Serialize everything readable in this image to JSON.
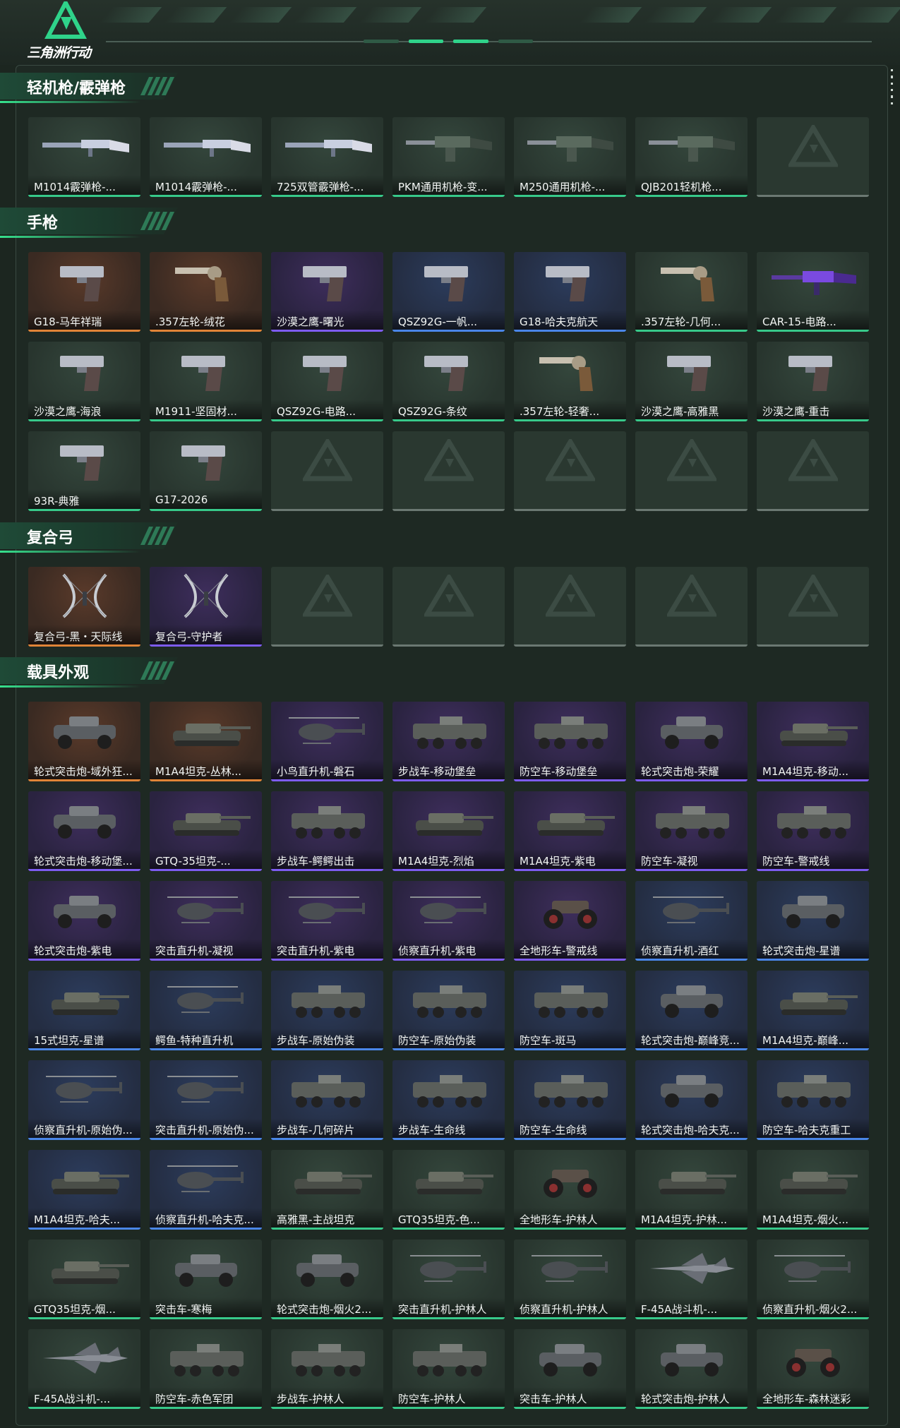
{
  "app": {
    "logo_text": "三角洲行动"
  },
  "sections": [
    {
      "title": "轻机枪/霰弹枪",
      "items": [
        {
          "label": "M1014霰弹枪-...",
          "rarity": "green",
          "kind": "shotgun"
        },
        {
          "label": "M1014霰弹枪-...",
          "rarity": "green",
          "kind": "shotgun"
        },
        {
          "label": "725双管霰弹枪-...",
          "rarity": "green",
          "kind": "shotgun"
        },
        {
          "label": "PKM通用机枪-变...",
          "rarity": "green",
          "kind": "mg"
        },
        {
          "label": "M250通用机枪-...",
          "rarity": "green",
          "kind": "mg"
        },
        {
          "label": "QJB201轻机枪...",
          "rarity": "green",
          "kind": "mg"
        },
        {
          "label": "",
          "rarity": "empty",
          "kind": "empty"
        }
      ]
    },
    {
      "title": "手枪",
      "items": [
        {
          "label": "G18-马年祥瑞",
          "rarity": "orange",
          "kind": "pistol"
        },
        {
          "label": ".357左轮-绒花",
          "rarity": "orange",
          "kind": "revolver"
        },
        {
          "label": "沙漠之鹰-曙光",
          "rarity": "purple",
          "kind": "pistol"
        },
        {
          "label": "QSZ92G-一帆...",
          "rarity": "blue",
          "kind": "pistol"
        },
        {
          "label": "G18-哈夫克航天",
          "rarity": "blue",
          "kind": "pistol"
        },
        {
          "label": ".357左轮-几何...",
          "rarity": "green",
          "kind": "revolver"
        },
        {
          "label": "CAR-15-电路...",
          "rarity": "green",
          "kind": "rifle"
        },
        {
          "label": "沙漠之鹰-海浪",
          "rarity": "green",
          "kind": "pistol"
        },
        {
          "label": "M1911-坚固材...",
          "rarity": "green",
          "kind": "pistol"
        },
        {
          "label": "QSZ92G-电路...",
          "rarity": "green",
          "kind": "pistol"
        },
        {
          "label": "QSZ92G-条纹",
          "rarity": "green",
          "kind": "pistol"
        },
        {
          "label": ".357左轮-轻奢...",
          "rarity": "green",
          "kind": "revolver"
        },
        {
          "label": "沙漠之鹰-高雅黑",
          "rarity": "green",
          "kind": "pistol"
        },
        {
          "label": "沙漠之鹰-重击",
          "rarity": "green",
          "kind": "pistol"
        },
        {
          "label": "93R-典雅",
          "rarity": "green",
          "kind": "pistol"
        },
        {
          "label": "G17-2026",
          "rarity": "green",
          "kind": "pistol"
        },
        {
          "label": "",
          "rarity": "empty",
          "kind": "empty"
        },
        {
          "label": "",
          "rarity": "empty",
          "kind": "empty"
        },
        {
          "label": "",
          "rarity": "empty",
          "kind": "empty"
        },
        {
          "label": "",
          "rarity": "empty",
          "kind": "empty"
        },
        {
          "label": "",
          "rarity": "empty",
          "kind": "empty"
        }
      ]
    },
    {
      "title": "复合弓",
      "items": [
        {
          "label": "复合弓-黑・天际线",
          "rarity": "orange",
          "kind": "bow"
        },
        {
          "label": "复合弓-守护者",
          "rarity": "purple",
          "kind": "bow"
        },
        {
          "label": "",
          "rarity": "empty",
          "kind": "empty"
        },
        {
          "label": "",
          "rarity": "empty",
          "kind": "empty"
        },
        {
          "label": "",
          "rarity": "empty",
          "kind": "empty"
        },
        {
          "label": "",
          "rarity": "empty",
          "kind": "empty"
        },
        {
          "label": "",
          "rarity": "empty",
          "kind": "empty"
        }
      ]
    },
    {
      "title": "载具外观",
      "items": [
        {
          "label": "轮式突击炮-域外狂...",
          "rarity": "orange",
          "kind": "car"
        },
        {
          "label": "M1A4坦克-丛林...",
          "rarity": "orange",
          "kind": "tank"
        },
        {
          "label": "小鸟直升机-磐石",
          "rarity": "purple",
          "kind": "heli"
        },
        {
          "label": "步战车-移动堡垒",
          "rarity": "purple",
          "kind": "ifv"
        },
        {
          "label": "防空车-移动堡垒",
          "rarity": "purple",
          "kind": "ifv"
        },
        {
          "label": "轮式突击炮-荣耀",
          "rarity": "purple",
          "kind": "car"
        },
        {
          "label": "M1A4坦克-移动...",
          "rarity": "purple",
          "kind": "tank"
        },
        {
          "label": "轮式突击炮-移动堡...",
          "rarity": "purple",
          "kind": "car"
        },
        {
          "label": "GTQ-35坦克-...",
          "rarity": "purple",
          "kind": "tank"
        },
        {
          "label": "步战车-鳄鳄出击",
          "rarity": "purple",
          "kind": "ifv"
        },
        {
          "label": "M1A4坦克-烈焰",
          "rarity": "purple",
          "kind": "tank"
        },
        {
          "label": "M1A4坦克-紫电",
          "rarity": "purple",
          "kind": "tank"
        },
        {
          "label": "防空车-凝视",
          "rarity": "purple",
          "kind": "ifv"
        },
        {
          "label": "防空车-警戒线",
          "rarity": "purple",
          "kind": "ifv"
        },
        {
          "label": "轮式突击炮-紫电",
          "rarity": "purple",
          "kind": "car"
        },
        {
          "label": "突击直升机-凝视",
          "rarity": "purple",
          "kind": "heli"
        },
        {
          "label": "突击直升机-紫电",
          "rarity": "purple",
          "kind": "heli"
        },
        {
          "label": "侦察直升机-紫电",
          "rarity": "purple",
          "kind": "heli"
        },
        {
          "label": "全地形车-警戒线",
          "rarity": "purple",
          "kind": "atv"
        },
        {
          "label": "侦察直升机-酒红",
          "rarity": "blue",
          "kind": "heli"
        },
        {
          "label": "轮式突击炮-星谱",
          "rarity": "blue",
          "kind": "car"
        },
        {
          "label": "15式坦克-星谱",
          "rarity": "blue",
          "kind": "tank"
        },
        {
          "label": "鳄鱼-特种直升机",
          "rarity": "blue",
          "kind": "heli"
        },
        {
          "label": "步战车-原始伪装",
          "rarity": "blue",
          "kind": "ifv"
        },
        {
          "label": "防空车-原始伪装",
          "rarity": "blue",
          "kind": "ifv"
        },
        {
          "label": "防空车-斑马",
          "rarity": "blue",
          "kind": "ifv"
        },
        {
          "label": "轮式突击炮-巅峰竞...",
          "rarity": "blue",
          "kind": "car"
        },
        {
          "label": "M1A4坦克-巅峰...",
          "rarity": "blue",
          "kind": "tank"
        },
        {
          "label": "侦察直升机-原始伪...",
          "rarity": "blue",
          "kind": "heli"
        },
        {
          "label": "突击直升机-原始伪...",
          "rarity": "blue",
          "kind": "heli"
        },
        {
          "label": "步战车-几何碎片",
          "rarity": "blue",
          "kind": "ifv"
        },
        {
          "label": "步战车-生命线",
          "rarity": "blue",
          "kind": "ifv"
        },
        {
          "label": "防空车-生命线",
          "rarity": "blue",
          "kind": "ifv"
        },
        {
          "label": "轮式突击炮-哈夫克...",
          "rarity": "blue",
          "kind": "car"
        },
        {
          "label": "防空车-哈夫克重工",
          "rarity": "blue",
          "kind": "ifv"
        },
        {
          "label": "M1A4坦克-哈夫...",
          "rarity": "blue",
          "kind": "tank"
        },
        {
          "label": "侦察直升机-哈夫克...",
          "rarity": "blue",
          "kind": "heli"
        },
        {
          "label": "高雅黑-主战坦克",
          "rarity": "green",
          "kind": "tank"
        },
        {
          "label": "GTQ35坦克-色...",
          "rarity": "green",
          "kind": "tank"
        },
        {
          "label": "全地形车-护林人",
          "rarity": "green",
          "kind": "atv"
        },
        {
          "label": "M1A4坦克-护林...",
          "rarity": "green",
          "kind": "tank"
        },
        {
          "label": "M1A4坦克-烟火...",
          "rarity": "green",
          "kind": "tank"
        },
        {
          "label": "GTQ35坦克-烟...",
          "rarity": "green",
          "kind": "tank"
        },
        {
          "label": "突击车-寒梅",
          "rarity": "green",
          "kind": "car"
        },
        {
          "label": "轮式突击炮-烟火2...",
          "rarity": "green",
          "kind": "car"
        },
        {
          "label": "突击直升机-护林人",
          "rarity": "green",
          "kind": "heli"
        },
        {
          "label": "侦察直升机-护林人",
          "rarity": "green",
          "kind": "heli"
        },
        {
          "label": "F-45A战斗机-...",
          "rarity": "green",
          "kind": "jet"
        },
        {
          "label": "侦察直升机-烟火2...",
          "rarity": "green",
          "kind": "heli"
        },
        {
          "label": "F-45A战斗机-...",
          "rarity": "green",
          "kind": "jet"
        },
        {
          "label": "防空车-赤色军团",
          "rarity": "green",
          "kind": "ifv"
        },
        {
          "label": "步战车-护林人",
          "rarity": "green",
          "kind": "ifv"
        },
        {
          "label": "防空车-护林人",
          "rarity": "green",
          "kind": "ifv"
        },
        {
          "label": "突击车-护林人",
          "rarity": "green",
          "kind": "car"
        },
        {
          "label": "轮式突击炮-护林人",
          "rarity": "green",
          "kind": "car"
        },
        {
          "label": "全地形车-森林迷彩",
          "rarity": "green",
          "kind": "atv"
        }
      ]
    }
  ],
  "colors": {
    "accent": "#36e08d",
    "rarity_orange": "#e08437",
    "rarity_purple": "#7d5cf0",
    "rarity_blue": "#4a86e8",
    "rarity_green": "#37c98a",
    "empty": "#6b7872"
  }
}
